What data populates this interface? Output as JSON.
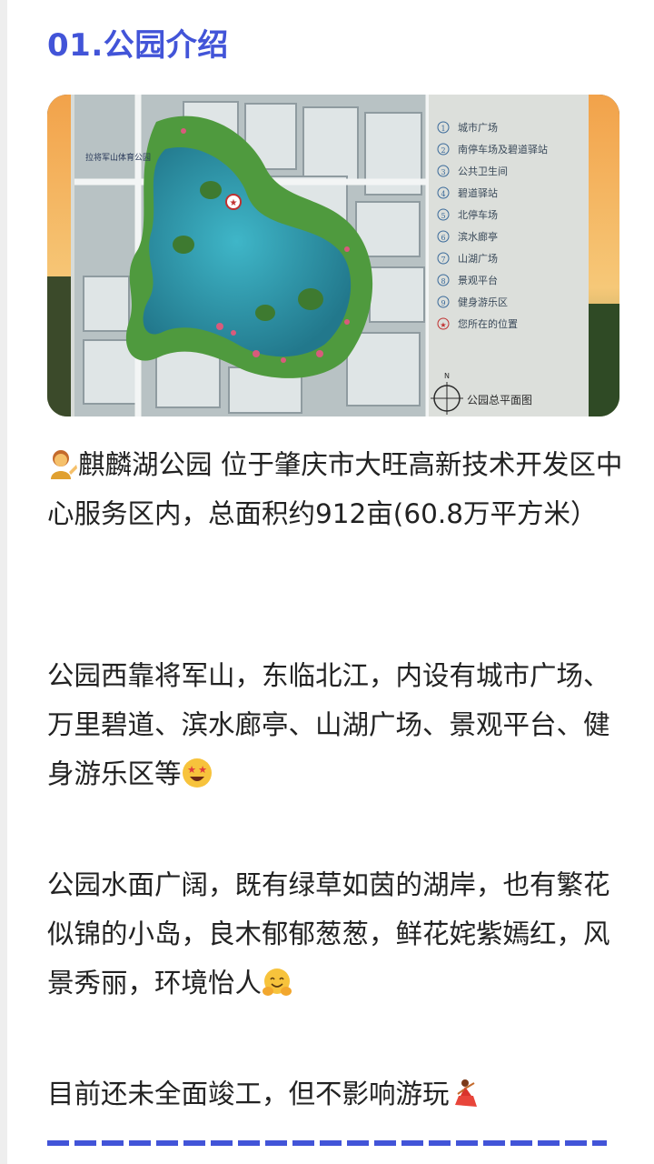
{
  "section": {
    "title": "01.公园介绍"
  },
  "map": {
    "west_label": "拉将军山体育公园",
    "legend_items": [
      {
        "num": "1",
        "label": "城市广场"
      },
      {
        "num": "2",
        "label": "南停车场及碧道驿站"
      },
      {
        "num": "3",
        "label": "公共卫生间"
      },
      {
        "num": "4",
        "label": "碧道驿站"
      },
      {
        "num": "5",
        "label": "北停车场"
      },
      {
        "num": "6",
        "label": "滨水廊亭"
      },
      {
        "num": "7",
        "label": "山湖广场"
      },
      {
        "num": "8",
        "label": "景观平台"
      },
      {
        "num": "9",
        "label": "健身游乐区"
      },
      {
        "num": "★",
        "label": "您所在的位置"
      }
    ],
    "compass_label": "N",
    "plan_title": "公园总平面图"
  },
  "paragraphs": {
    "p1": "麒麟湖公园 位于肇庆市大旺高新技术开发区中心服务区内，总面积约912亩(60.8万平方米）",
    "p2": "公园西靠将军山，东临北江，内设有城市广场、万里碧道、滨水廊亭、山湖广场、景观平台、健身游乐区等",
    "p3": "公园水面广阔，既有绿草如茵的湖岸，也有繁花似锦的小岛，良木郁郁葱葱，鲜花姹紫嫣红，风景秀丽，环境怡人",
    "p4": "目前还未全面竣工，但不影响游玩"
  },
  "icons": {
    "p1_start": "person-tipping-hand-icon",
    "p2_end": "star-struck-face-icon",
    "p3_end": "hugging-face-icon",
    "p4_end": "dancer-icon"
  },
  "colors": {
    "accent": "#4254d8",
    "text": "#222222",
    "lake": "#2e9bb0",
    "grass": "#4f9a3e"
  }
}
